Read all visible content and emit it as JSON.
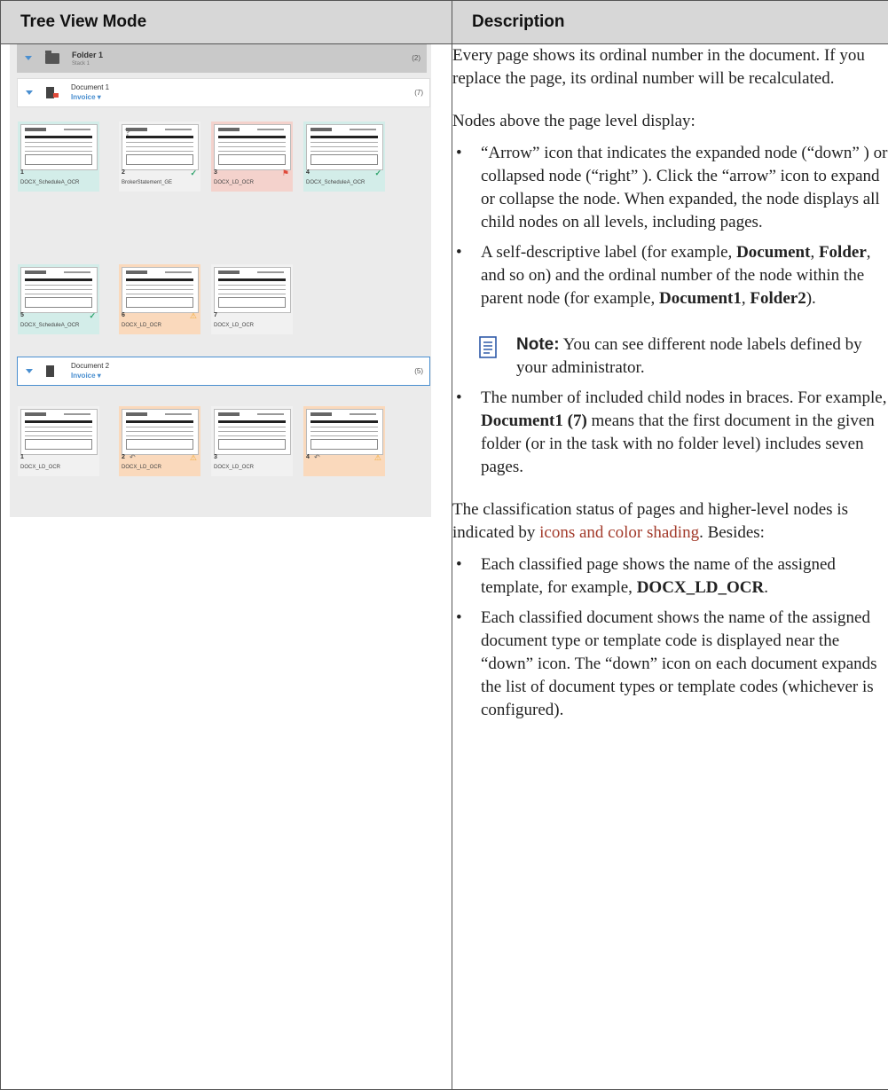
{
  "header": {
    "left": "Tree View Mode",
    "right": "Description"
  },
  "tree": {
    "folder": {
      "title": "Folder 1",
      "subtitle": "Stack 1",
      "count": "(2)"
    },
    "documents": [
      {
        "title": "Document 1",
        "type": "Invoice ▾",
        "count": "(7)"
      },
      {
        "title": "Document 2",
        "type": "Invoice ▾",
        "count": "(5)"
      }
    ],
    "pages": [
      {
        "num": "1",
        "name": "DOCX_ScheduleA_OCR",
        "status": "",
        "color": "#d3ede9"
      },
      {
        "num": "2",
        "name": "BrokerStatement_GE",
        "status": "✓",
        "color": "#f1f1f1"
      },
      {
        "num": "3",
        "name": "DOCX_LD_OCR",
        "status": "⚑",
        "color": "#f4d2cc"
      },
      {
        "num": "4",
        "name": "DOCX_ScheduleA_OCR",
        "status": "✓",
        "color": "#d3ede9"
      },
      {
        "num": "5",
        "name": "DOCX_ScheduleA_OCR",
        "status": "✓",
        "color": "#d3ede9"
      },
      {
        "num": "6",
        "name": "DOCX_LD_OCR",
        "status": "⚠",
        "color": "#fad9bc"
      },
      {
        "num": "7",
        "name": "DOCX_LD_OCR",
        "status": "",
        "color": "#f1f1f1"
      },
      {
        "num": "1",
        "name": "DOCX_LD_OCR",
        "status": "",
        "color": "#f1f1f1"
      },
      {
        "num": "2",
        "name": "DOCX_LD_OCR",
        "status": "⚠",
        "color": "#fad9bc"
      },
      {
        "num": "3",
        "name": "DOCX_LD_OCR",
        "status": "",
        "color": "#f1f1f1"
      },
      {
        "num": "4",
        "name": "",
        "status": "⚠",
        "color": "#fad9bc"
      }
    ]
  },
  "description": {
    "p1": "Every page shows its ordinal number in the document. If you replace the page, its ordinal number will be recalculated.",
    "p2": "Nodes above the page level display:",
    "b1": "“Arrow” icon that indicates the expanded node (“down” ) or collapsed node (“right” ). Click the “arrow” icon to expand or collapse the node. When expanded, the node displays all child nodes on all levels, including pages.",
    "b2_a": "A self-descriptive label (for example, ",
    "b2_b1": "Document",
    "b2_c": ", ",
    "b2_b2": "Folder",
    "b2_d": ", and so on) and the ordinal number of the node within the parent node (for example, ",
    "b2_b3": "Document1",
    "b2_e": ", ",
    "b2_b4": "Folder2",
    "b2_f": ").",
    "note_label": "Note:",
    "note_text": " You can see different node labels defined by your administrator.",
    "b3_a": "The number of included child nodes in braces. For example, ",
    "b3_b": "Document1 (7)",
    "b3_c": " means that the first document in the given folder (or in the task with no folder level) includes seven pages.",
    "p3_a": "The classification status of pages and higher-level nodes is indicated by ",
    "p3_link": "icons and color shading",
    "p3_b": ". Besides:",
    "b4_a": "Each classified page shows the name of the assigned template, for example, ",
    "b4_b": "DOCX_LD_OCR",
    "b4_c": ".",
    "b5": "Each classified document shows the name of the assigned document type or template code is displayed near the “down” icon. The “down” icon on each document expands the list of document types or template codes (whichever is configured).",
    "bullet": "•"
  }
}
